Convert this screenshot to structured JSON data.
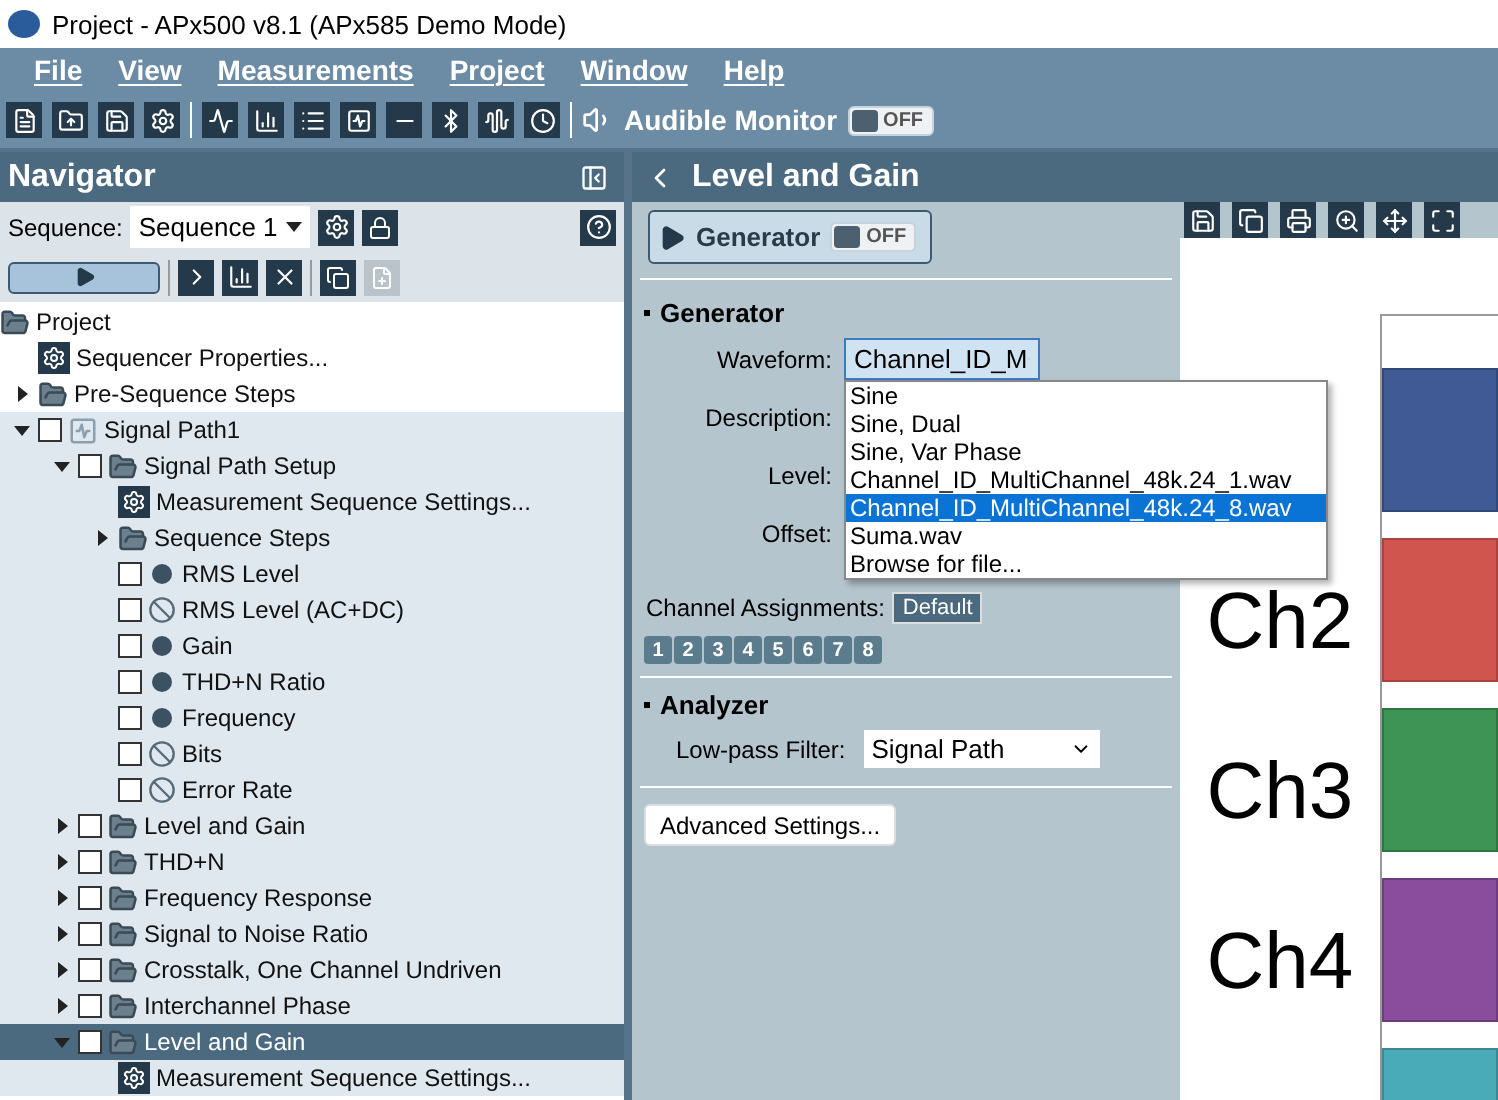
{
  "window": {
    "title": "Project - APx500 v8.1 (APx585 Demo Mode)"
  },
  "menu": [
    "File",
    "View",
    "Measurements",
    "Project",
    "Window",
    "Help"
  ],
  "toolbar": {
    "audible_monitor": {
      "label": "Audible Monitor",
      "on": false,
      "state_text": "OFF"
    }
  },
  "navigator": {
    "title": "Navigator",
    "sequence_label": "Sequence:",
    "sequence_value": "Sequence 1",
    "tree": [
      {
        "label": "Project",
        "kind": "folder",
        "children": [
          {
            "label": "Sequencer Properties...",
            "kind": "gear"
          },
          {
            "label": "Pre-Sequence Steps",
            "kind": "folder",
            "expanded": false
          },
          {
            "label": "Signal Path1",
            "kind": "path",
            "checked": false,
            "expanded": true,
            "children": [
              {
                "label": "Signal Path Setup",
                "kind": "folder",
                "checked": false,
                "expanded": true,
                "children": [
                  {
                    "label": "Measurement Sequence Settings...",
                    "kind": "gear"
                  },
                  {
                    "label": "Sequence Steps",
                    "kind": "folder",
                    "expanded": false
                  },
                  {
                    "label": "RMS Level",
                    "kind": "dot",
                    "checked": false
                  },
                  {
                    "label": "RMS Level (AC+DC)",
                    "kind": "blocked",
                    "checked": false
                  },
                  {
                    "label": "Gain",
                    "kind": "dot",
                    "checked": false
                  },
                  {
                    "label": "THD+N Ratio",
                    "kind": "dot",
                    "checked": false
                  },
                  {
                    "label": "Frequency",
                    "kind": "dot",
                    "checked": false
                  },
                  {
                    "label": "Bits",
                    "kind": "blocked",
                    "checked": false
                  },
                  {
                    "label": "Error Rate",
                    "kind": "blocked",
                    "checked": false
                  }
                ]
              },
              {
                "label": "Level and Gain",
                "kind": "folder",
                "checked": false,
                "expanded": false,
                "selected": false
              },
              {
                "label": "THD+N",
                "kind": "folder",
                "checked": false,
                "expanded": false,
                "selected": false
              },
              {
                "label": "Frequency Response",
                "kind": "folder",
                "checked": false,
                "expanded": false,
                "selected": false
              },
              {
                "label": "Signal to Noise Ratio",
                "kind": "folder",
                "checked": false,
                "expanded": false,
                "selected": false
              },
              {
                "label": "Crosstalk, One Channel Undriven",
                "kind": "folder",
                "checked": false,
                "expanded": false,
                "selected": false
              },
              {
                "label": "Interchannel Phase",
                "kind": "folder",
                "checked": false,
                "expanded": false,
                "selected": false
              },
              {
                "label": "Level and Gain",
                "kind": "folder",
                "checked": false,
                "expanded": true,
                "selected": true,
                "children": [
                  {
                    "label": "Measurement Sequence Settings...",
                    "kind": "gear"
                  }
                ]
              }
            ]
          }
        ]
      }
    ]
  },
  "panel": {
    "title": "Level and Gain",
    "generator_button": {
      "label": "Generator",
      "on": false,
      "state_text": "OFF"
    },
    "generator": {
      "heading": "Generator",
      "waveform_label": "Waveform:",
      "waveform_value": "Channel_ID_M",
      "waveform_options": [
        {
          "label": "Sine",
          "selected": false
        },
        {
          "label": "Sine, Dual",
          "selected": false
        },
        {
          "label": "Sine, Var Phase",
          "selected": false
        },
        {
          "label": "Channel_ID_MultiChannel_48k.24_1.wav",
          "selected": false
        },
        {
          "label": "Channel_ID_MultiChannel_48k.24_8.wav",
          "selected": true
        },
        {
          "label": "Suma.wav",
          "selected": false
        },
        {
          "label": "Browse for file...",
          "selected": false
        }
      ],
      "fields": [
        "Description:",
        "Level:",
        "Offset:"
      ],
      "channel_assignments_label": "Channel Assignments:",
      "channel_assignments_value": "Default",
      "channels": [
        "1",
        "2",
        "3",
        "4",
        "5",
        "6",
        "7",
        "8"
      ]
    },
    "analyzer": {
      "heading": "Analyzer",
      "lowpass_label": "Low-pass Filter:",
      "lowpass_value": "Signal Path"
    },
    "advanced_button": "Advanced Settings..."
  },
  "graph": {
    "channels": [
      {
        "color": "#3f5a94"
      },
      {
        "label": "Ch2",
        "color": "#d1554f"
      },
      {
        "label": "Ch3",
        "color": "#3d9454"
      },
      {
        "label": "Ch4",
        "color": "#8a4c9c"
      },
      {
        "color": "#4aabb8"
      }
    ]
  }
}
